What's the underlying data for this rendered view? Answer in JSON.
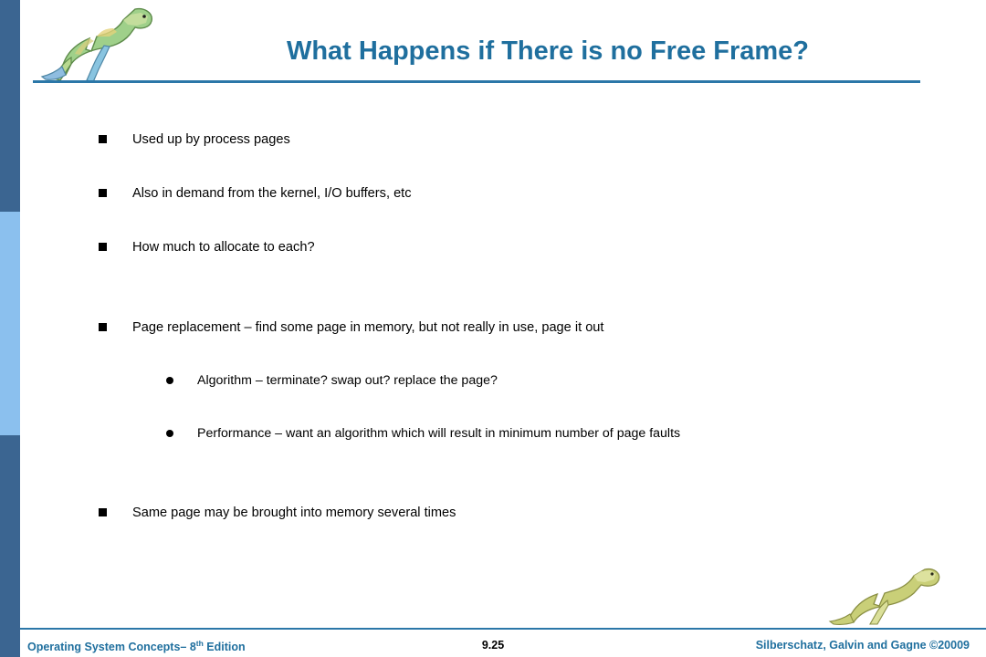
{
  "slide": {
    "title": "What Happens if There is no Free Frame?",
    "bullets": [
      {
        "level": 1,
        "marker": "square-bullet",
        "text": "Used up by process pages"
      },
      {
        "level": 1,
        "marker": "square-bullet",
        "text": "Also in demand from the kernel, I/O buffers, etc"
      },
      {
        "level": 1,
        "marker": "square-bullet",
        "text": "How much to allocate to each?"
      },
      {
        "level": 1,
        "marker": "square-bullet",
        "text": "Page replacement – find some page in memory, but not really in use, page it out"
      },
      {
        "level": 2,
        "marker": "round-bullet",
        "text": "Algorithm – terminate? swap out? replace the page?"
      },
      {
        "level": 2,
        "marker": "round-bullet",
        "text": "Performance – want an algorithm which will result in minimum number of page faults"
      },
      {
        "level": 1,
        "marker": "square-bullet",
        "text": "Same page may be brought into memory several times"
      }
    ]
  },
  "footer": {
    "left_main": "Operating System Concepts– 8",
    "left_sup": "th",
    "left_tail": " Edition",
    "center": "9.25",
    "right": "Silberschatz, Galvin and Gagne ©20009"
  },
  "colors": {
    "accent": "#1f6f9e",
    "rule": "#2b77a8",
    "bar_dark": "#3b6591",
    "bar_light": "#8bc0ee"
  },
  "decorations": {
    "logo_top": "dinosaur-logo",
    "logo_bottom": "dinosaur-logo"
  }
}
